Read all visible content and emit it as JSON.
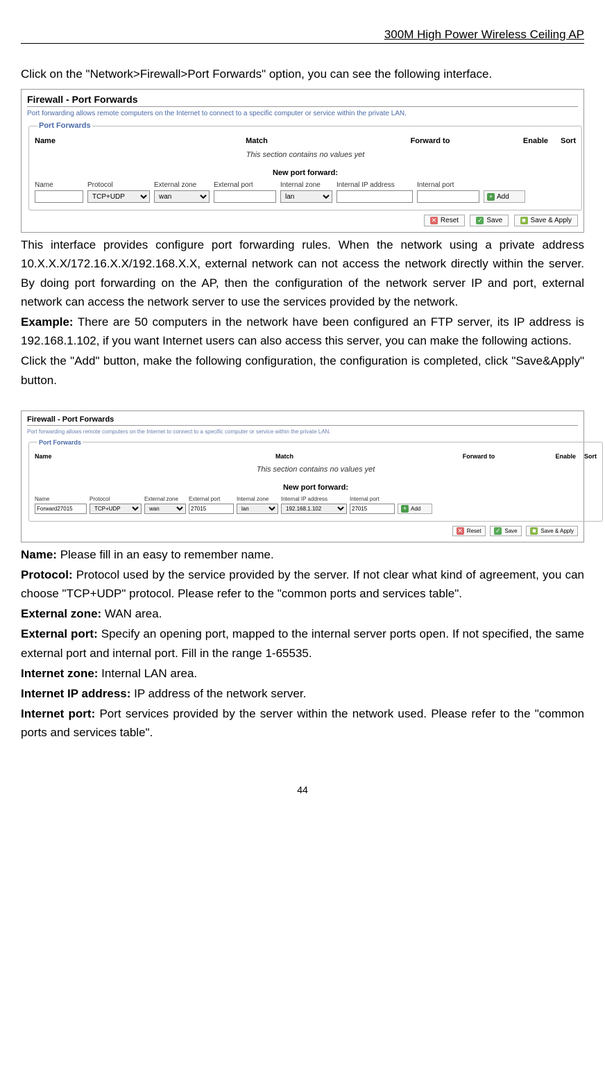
{
  "header": {
    "title": "300M High Power Wireless Ceiling AP"
  },
  "intro1": "Click on the \"Network>Firewall>Port Forwards\" option, you can see the following interface.",
  "panel1": {
    "title": "Firewall - Port Forwards",
    "desc": "Port forwarding allows remote computers on the Internet to connect to a specific computer or service within the private LAN.",
    "legend": "Port Forwards",
    "head": {
      "name": "Name",
      "match": "Match",
      "forward": "Forward to",
      "enable": "Enable",
      "sort": "Sort"
    },
    "empty": "This section contains no values yet",
    "newport": "New port forward:",
    "labels": {
      "name": "Name",
      "protocol": "Protocol",
      "extzone": "External zone",
      "extport": "External port",
      "intzone": "Internal zone",
      "intip": "Internal IP address",
      "intport": "Internal port"
    },
    "values": {
      "name": "",
      "protocol": "TCP+UDP",
      "extzone": "wan",
      "extport": "",
      "intzone": "lan",
      "intip": "",
      "intport": ""
    },
    "add": "Add",
    "buttons": {
      "reset": "Reset",
      "save": "Save",
      "saveapply": "Save & Apply"
    }
  },
  "body1": "This interface provides configure port forwarding rules. When the network using a private address 10.X.X.X/172.16.X.X/192.168.X.X, external network can not access the network directly within the server. By doing port forwarding on the AP, then the configuration of the network server IP and port, external network can access the network server to use the services provided by the network.",
  "example_label": "Example:",
  "example_text": " There are 50 computers in the network have been configured an FTP server, its IP address is 192.168.1.102, if you want Internet users can also access this server, you can make the following actions.",
  "body2": "Click the \"Add\" button, make the following configuration, the configuration is completed, click \"Save&Apply\" button.",
  "panel2": {
    "title": "Firewall - Port Forwards",
    "desc": "Port forwarding allows remote computers on the Internet to connect to a specific computer or service within the private LAN.",
    "legend": "Port Forwards",
    "head": {
      "name": "Name",
      "match": "Match",
      "forward": "Forward to",
      "enable": "Enable",
      "sort": "Sort"
    },
    "empty": "This section contains no values yet",
    "newport": "New port forward:",
    "labels": {
      "name": "Name",
      "protocol": "Protocol",
      "extzone": "External zone",
      "extport": "External port",
      "intzone": "Internal zone",
      "intip": "Internal IP address",
      "intport": "Internal port"
    },
    "values": {
      "name": "Forward27015",
      "protocol": "TCP+UDP",
      "extzone": "wan",
      "extport": "27015",
      "intzone": "lan",
      "intip": "192.168.1.102",
      "intport": "27015"
    },
    "add": "Add",
    "buttons": {
      "reset": "Reset",
      "save": "Save",
      "saveapply": "Save & Apply"
    }
  },
  "defs": {
    "name_l": "Name:",
    "name_t": " Please fill in an easy to remember name.",
    "protocol_l": "Protocol:",
    "protocol_t": " Protocol used by the service provided by the server. If not clear what kind of agreement, you can choose \"TCP+UDP\" protocol. Please refer to the \"common ports and services table\".",
    "extzone_l": "External zone:",
    "extzone_t": " WAN area.",
    "extport_l": "External port:",
    "extport_t": " Specify an opening port, mapped to the internal server ports open. If not specified, the same external port and internal port. Fill in the range 1-65535.",
    "intzone_l": "Internet zone:",
    "intzone_t": " Internal LAN area.",
    "intip_l": "Internet IP address:",
    "intip_t": " IP address of the network server.",
    "intport_l": "Internet port:",
    "intport_t": " Port services provided by the server within the network used. Please refer to the \"common ports and services table\"."
  },
  "page": "44"
}
